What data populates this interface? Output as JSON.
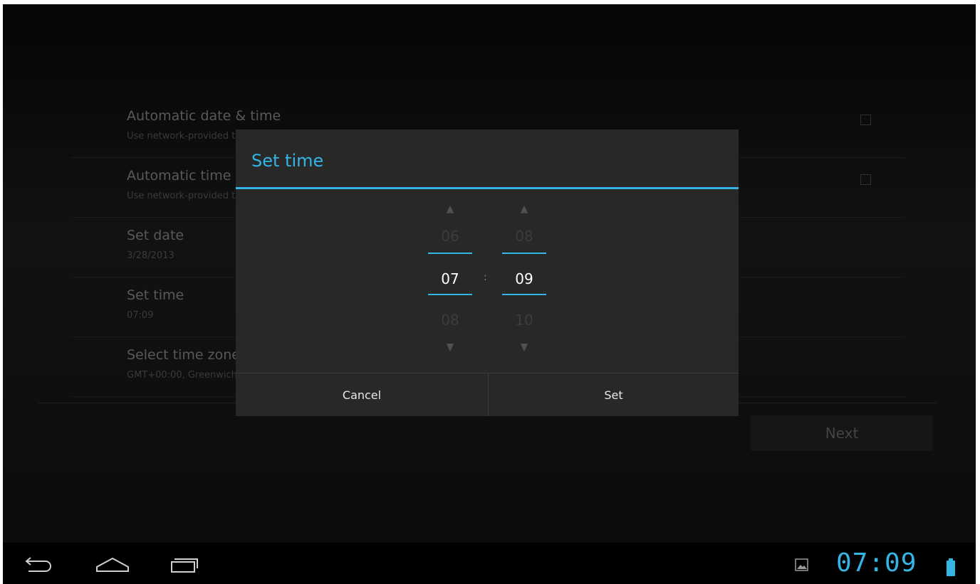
{
  "settings": {
    "rows": [
      {
        "title": "Automatic date & time",
        "subtitle": "Use network-provided time",
        "has_checkbox": true
      },
      {
        "title": "Automatic time zone",
        "subtitle": "Use network-provided time zone",
        "has_checkbox": true
      },
      {
        "title": "Set date",
        "subtitle": "3/28/2013",
        "has_checkbox": false
      },
      {
        "title": "Set time",
        "subtitle": "07:09",
        "has_checkbox": false
      },
      {
        "title": "Select time zone",
        "subtitle": "GMT+00:00, Greenwich Mean Time",
        "has_checkbox": false
      }
    ],
    "next_label": "Next"
  },
  "dialog": {
    "title": "Set time",
    "hour": {
      "prev": "06",
      "current": "07",
      "next": "08"
    },
    "minute": {
      "prev": "08",
      "current": "09",
      "next": "10"
    },
    "separator": ":",
    "cancel_label": "Cancel",
    "set_label": "Set"
  },
  "status_bar": {
    "clock": "07:09"
  },
  "colors": {
    "accent": "#33b5e5"
  }
}
